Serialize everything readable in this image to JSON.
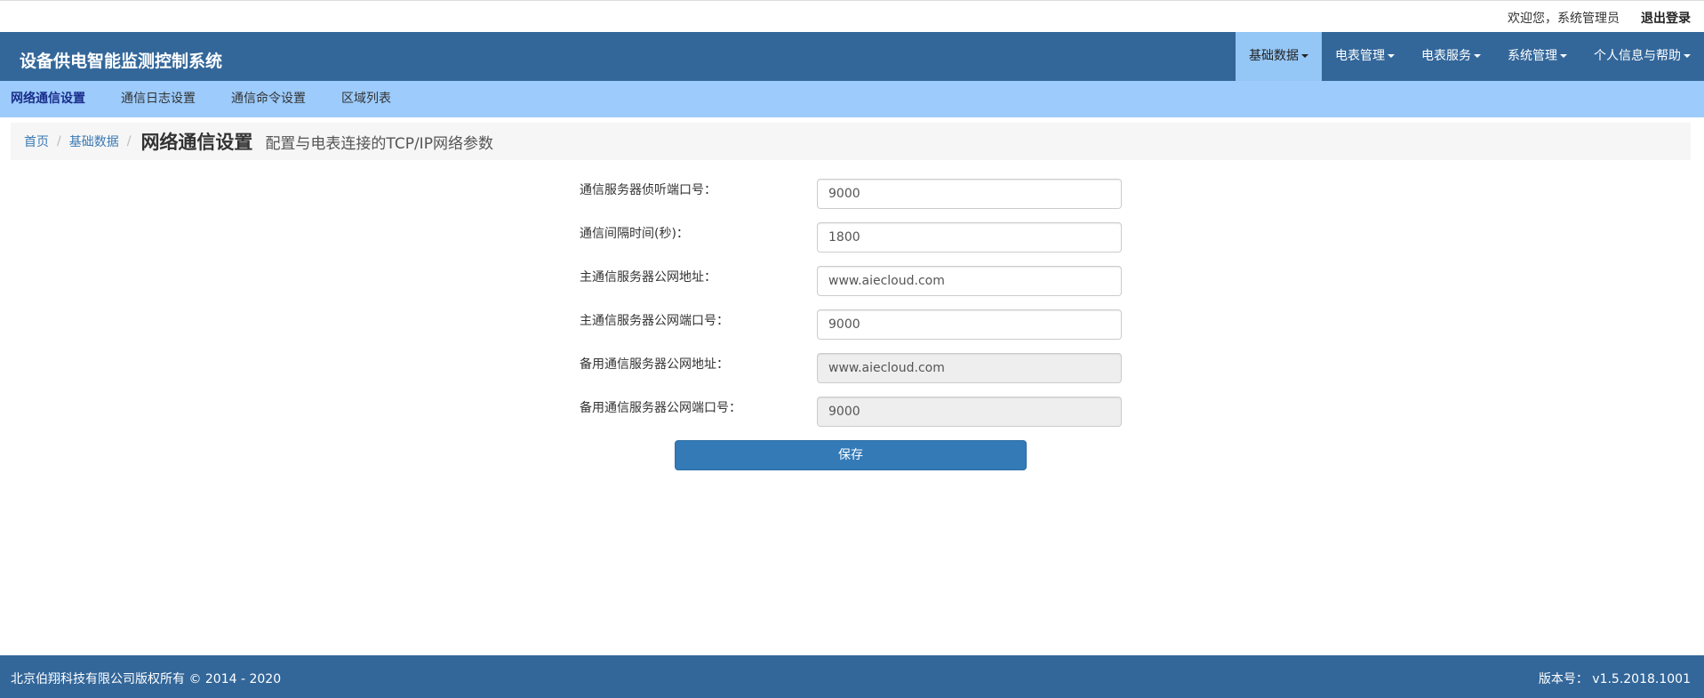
{
  "topbar": {
    "welcome": "欢迎您，系统管理员",
    "logout": "退出登录"
  },
  "header": {
    "brand": "设备供电智能监测控制系统",
    "nav": [
      {
        "label": "基础数据"
      },
      {
        "label": "电表管理"
      },
      {
        "label": "电表服务"
      },
      {
        "label": "系统管理"
      },
      {
        "label": "个人信息与帮助"
      }
    ]
  },
  "subnav": {
    "items": [
      {
        "label": "网络通信设置"
      },
      {
        "label": "通信日志设置"
      },
      {
        "label": "通信命令设置"
      },
      {
        "label": "区域列表"
      }
    ]
  },
  "breadcrumb": {
    "home": "首页",
    "section": "基础数据",
    "sep": "/",
    "title": "网络通信设置",
    "description": "配置与电表连接的TCP/IP网络参数"
  },
  "form": {
    "fields": [
      {
        "label": "通信服务器侦听端口号：",
        "value": "9000"
      },
      {
        "label": "通信间隔时间(秒)：",
        "value": "1800"
      },
      {
        "label": "主通信服务器公网地址：",
        "value": "www.aiecloud.com"
      },
      {
        "label": "主通信服务器公网端口号：",
        "value": "9000"
      },
      {
        "label": "备用通信服务器公网地址：",
        "value": "www.aiecloud.com"
      },
      {
        "label": "备用通信服务器公网端口号：",
        "value": "9000"
      }
    ],
    "save_label": "保存"
  },
  "footer": {
    "copyright": "北京伯翔科技有限公司版权所有 © 2014 - 2020",
    "version": "版本号： v1.5.2018.1001"
  },
  "colors": {
    "header_bg": "#33679a",
    "subnav_bg": "#9ccbfc",
    "active_nav_bg": "#94c6f6",
    "primary_button": "#337ab7"
  }
}
